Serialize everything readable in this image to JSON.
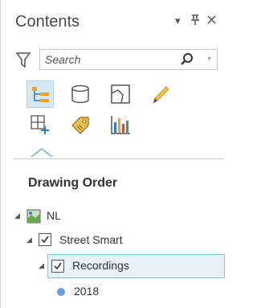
{
  "header": {
    "title": "Contents",
    "controls": [
      "options-icon",
      "pin-icon",
      "close-icon"
    ]
  },
  "search": {
    "placeholder": "Search"
  },
  "toolbar": {
    "buttons": [
      {
        "icon": "list-by-drawing-order-icon",
        "active": true
      },
      {
        "icon": "list-by-data-source-icon",
        "active": false
      },
      {
        "icon": "list-by-selection-icon",
        "active": false
      },
      {
        "icon": "list-by-editing-icon",
        "active": false
      },
      {
        "icon": "list-by-snapping-icon",
        "active": false
      },
      {
        "icon": "list-by-labeling-icon",
        "active": false
      },
      {
        "icon": "list-by-charts-icon",
        "active": false
      }
    ]
  },
  "section": {
    "title": "Drawing Order"
  },
  "tree": [
    {
      "label": "NL",
      "level": 0,
      "type": "map"
    },
    {
      "label": "Street Smart",
      "level": 1,
      "type": "group",
      "checked": true
    },
    {
      "label": "Recordings",
      "level": 2,
      "type": "layer",
      "checked": true,
      "selected": true
    },
    {
      "label": "2018",
      "level": 3,
      "type": "symbol",
      "color": "#6e9be6"
    }
  ],
  "colors": {
    "accent": "#2b7cd3",
    "selection_bg": "#e6f1fa",
    "selection_border": "#8ec0e6",
    "symbol": "#6e9be6"
  }
}
